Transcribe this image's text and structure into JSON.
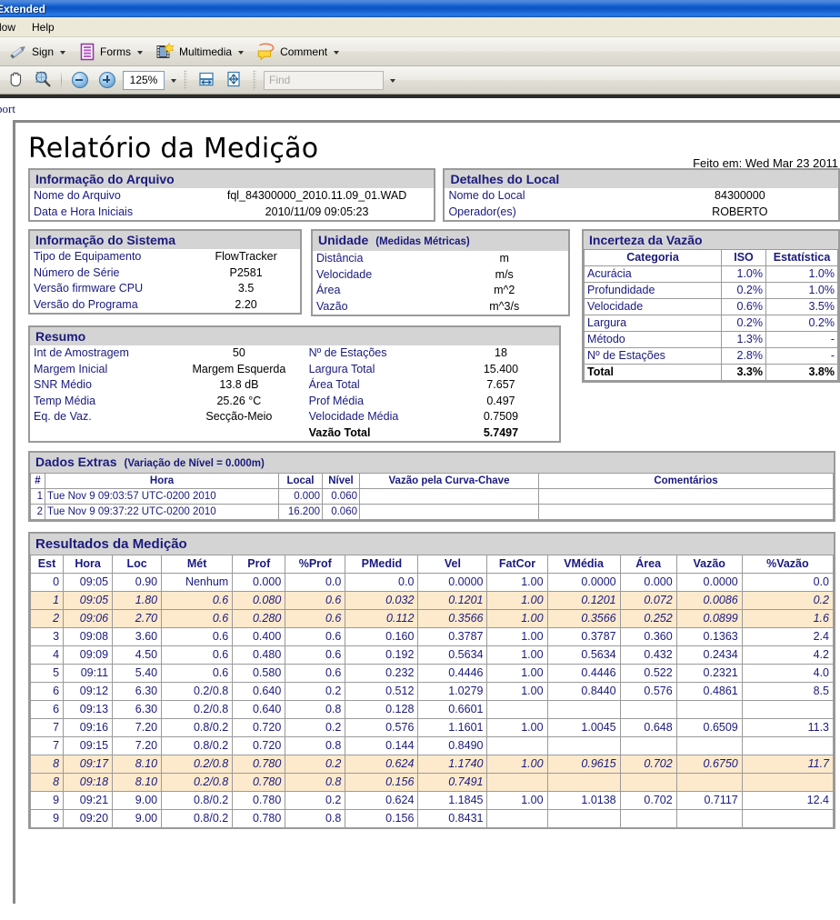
{
  "window": {
    "title": "Extended",
    "menus": [
      "dow",
      "Help"
    ]
  },
  "toolbar": {
    "buttons": [
      {
        "label": "Sign",
        "icon": "pen-icon",
        "caret": true
      },
      {
        "label": "Forms",
        "icon": "forms-icon",
        "caret": true
      },
      {
        "label": "Multimedia",
        "icon": "multimedia-icon",
        "caret": true
      },
      {
        "label": "Comment",
        "icon": "comment-icon",
        "caret": true
      }
    ]
  },
  "toolbar2": {
    "hand_icon": "hand-icon",
    "marquee_zoom_icon": "marquee-zoom-icon",
    "zoom_out_icon": "zoom-out-icon",
    "zoom_in_icon": "zoom-in-icon",
    "zoom_level": "125%",
    "zoom_dropdown_icon": "chevron-down-icon",
    "fit_width_icon": "fit-width-icon",
    "fit_page_icon": "fit-page-icon",
    "find_placeholder": "Find",
    "find_value": "",
    "find_dropdown_icon": "chevron-down-icon"
  },
  "bookmark_strip": {
    "label": "port"
  },
  "report": {
    "title": "Relatório da Medição",
    "made_on": "Feito em: Wed Mar 23 2011",
    "file_info": {
      "header": "Informação do Arquivo",
      "rows": [
        {
          "k": "Nome do Arquivo",
          "v": "fql_84300000_2010.11.09_01.WAD"
        },
        {
          "k": "Data e Hora Iniciais",
          "v": "2010/11/09 09:05:23"
        }
      ]
    },
    "site_details": {
      "header": "Detalhes do Local",
      "rows": [
        {
          "k": "Nome do Local",
          "v": "84300000"
        },
        {
          "k": "Operador(es)",
          "v": "ROBERTO"
        }
      ]
    },
    "system_info": {
      "header": "Informação do Sistema",
      "rows": [
        {
          "k": "Tipo de Equipamento",
          "v": "FlowTracker"
        },
        {
          "k": "Número de Série",
          "v": "P2581"
        },
        {
          "k": "Versão firmware CPU",
          "v": "3.5"
        },
        {
          "k": "Versão do Programa",
          "v": "2.20"
        }
      ]
    },
    "units": {
      "header": "Unidade",
      "header_sub": "(Medidas Métricas)",
      "rows": [
        {
          "k": "Distância",
          "v": "m"
        },
        {
          "k": "Velocidade",
          "v": "m/s"
        },
        {
          "k": "Área",
          "v": "m^2"
        },
        {
          "k": "Vazão",
          "v": "m^3/s"
        }
      ]
    },
    "uncertainty": {
      "header": "Incerteza da Vazão",
      "columns": [
        "Categoria",
        "ISO",
        "Estatística"
      ],
      "rows": [
        {
          "categoria": "Acurácia",
          "iso": "1.0%",
          "estatistica": "1.0%"
        },
        {
          "categoria": "Profundidade",
          "iso": "0.2%",
          "estatistica": "1.0%"
        },
        {
          "categoria": "Velocidade",
          "iso": "0.6%",
          "estatistica": "3.5%"
        },
        {
          "categoria": "Largura",
          "iso": "0.2%",
          "estatistica": "0.2%"
        },
        {
          "categoria": "Método",
          "iso": "1.3%",
          "estatistica": "-"
        },
        {
          "categoria": "Nº de Estações",
          "iso": "2.8%",
          "estatistica": "-"
        },
        {
          "categoria": "Total",
          "iso": "3.3%",
          "estatistica": "3.8%"
        }
      ]
    },
    "summary": {
      "header": "Resumo",
      "left": [
        {
          "k": "Int de Amostragem",
          "v": "50"
        },
        {
          "k": "Margem Inicial",
          "v": "Margem Esquerda"
        },
        {
          "k": "SNR Médio",
          "v": "13.8 dB"
        },
        {
          "k": "Temp Média",
          "v": "25.26 °C"
        },
        {
          "k": "Eq. de Vaz.",
          "v": "Secção-Meio"
        }
      ],
      "right": [
        {
          "k": "Nº de Estações",
          "v": "18"
        },
        {
          "k": "Largura Total",
          "v": "15.400"
        },
        {
          "k": "Área Total",
          "v": "7.657"
        },
        {
          "k": "Prof Média",
          "v": "0.497"
        },
        {
          "k": "Velocidade Média",
          "v": "0.7509"
        },
        {
          "k": "Vazão Total",
          "v": "5.7497"
        }
      ]
    },
    "extras": {
      "header": "Dados Extras",
      "header_sub": "(Variação de Nível = 0.000m)",
      "columns": [
        "#",
        "Hora",
        "Local",
        "Nível",
        "Vazão pela Curva-Chave",
        "Comentários"
      ],
      "rows": [
        {
          "n": "1",
          "hora": "Tue Nov 9 09:03:57 UTC-0200 2010",
          "local": "0.000",
          "nivel": "0.060",
          "vazao_curva": "",
          "comentarios": ""
        },
        {
          "n": "2",
          "hora": "Tue Nov 9 09:37:22 UTC-0200 2010",
          "local": "16.200",
          "nivel": "0.060",
          "vazao_curva": "",
          "comentarios": ""
        }
      ]
    },
    "results": {
      "header": "Resultados da Medição",
      "columns": [
        "Est",
        "Hora",
        "Loc",
        "Mét",
        "Prof",
        "%Prof",
        "PMedid",
        "Vel",
        "FatCor",
        "VMédia",
        "Área",
        "Vazão",
        "%Vazão"
      ],
      "rows": [
        {
          "highlight": false,
          "cells": [
            "0",
            "09:05",
            "0.90",
            "Nenhum",
            "0.000",
            "0.0",
            "0.0",
            "0.0000",
            "1.00",
            "0.0000",
            "0.000",
            "0.0000",
            "0.0"
          ]
        },
        {
          "highlight": true,
          "cells": [
            "1",
            "09:05",
            "1.80",
            "0.6",
            "0.080",
            "0.6",
            "0.032",
            "0.1201",
            "1.00",
            "0.1201",
            "0.072",
            "0.0086",
            "0.2"
          ]
        },
        {
          "highlight": true,
          "cells": [
            "2",
            "09:06",
            "2.70",
            "0.6",
            "0.280",
            "0.6",
            "0.112",
            "0.3566",
            "1.00",
            "0.3566",
            "0.252",
            "0.0899",
            "1.6"
          ]
        },
        {
          "highlight": false,
          "cells": [
            "3",
            "09:08",
            "3.60",
            "0.6",
            "0.400",
            "0.6",
            "0.160",
            "0.3787",
            "1.00",
            "0.3787",
            "0.360",
            "0.1363",
            "2.4"
          ]
        },
        {
          "highlight": false,
          "cells": [
            "4",
            "09:09",
            "4.50",
            "0.6",
            "0.480",
            "0.6",
            "0.192",
            "0.5634",
            "1.00",
            "0.5634",
            "0.432",
            "0.2434",
            "4.2"
          ]
        },
        {
          "highlight": false,
          "cells": [
            "5",
            "09:11",
            "5.40",
            "0.6",
            "0.580",
            "0.6",
            "0.232",
            "0.4446",
            "1.00",
            "0.4446",
            "0.522",
            "0.2321",
            "4.0"
          ]
        },
        {
          "highlight": false,
          "cells": [
            "6",
            "09:12",
            "6.30",
            "0.2/0.8",
            "0.640",
            "0.2",
            "0.512",
            "1.0279",
            "1.00",
            "0.8440",
            "0.576",
            "0.4861",
            "8.5"
          ]
        },
        {
          "highlight": false,
          "cells": [
            "6",
            "09:13",
            "6.30",
            "0.2/0.8",
            "0.640",
            "0.8",
            "0.128",
            "0.6601",
            "",
            "",
            "",
            "",
            ""
          ]
        },
        {
          "highlight": false,
          "cells": [
            "7",
            "09:16",
            "7.20",
            "0.8/0.2",
            "0.720",
            "0.2",
            "0.576",
            "1.1601",
            "1.00",
            "1.0045",
            "0.648",
            "0.6509",
            "11.3"
          ]
        },
        {
          "highlight": false,
          "cells": [
            "7",
            "09:15",
            "7.20",
            "0.8/0.2",
            "0.720",
            "0.8",
            "0.144",
            "0.8490",
            "",
            "",
            "",
            "",
            ""
          ]
        },
        {
          "highlight": true,
          "cells": [
            "8",
            "09:17",
            "8.10",
            "0.2/0.8",
            "0.780",
            "0.2",
            "0.624",
            "1.1740",
            "1.00",
            "0.9615",
            "0.702",
            "0.6750",
            "11.7"
          ]
        },
        {
          "highlight": true,
          "cells": [
            "8",
            "09:18",
            "8.10",
            "0.2/0.8",
            "0.780",
            "0.8",
            "0.156",
            "0.7491",
            "",
            "",
            "",
            "",
            ""
          ]
        },
        {
          "highlight": false,
          "cells": [
            "9",
            "09:21",
            "9.00",
            "0.8/0.2",
            "0.780",
            "0.2",
            "0.624",
            "1.1845",
            "1.00",
            "1.0138",
            "0.702",
            "0.7117",
            "12.4"
          ]
        },
        {
          "highlight": false,
          "cells": [
            "9",
            "09:20",
            "9.00",
            "0.8/0.2",
            "0.780",
            "0.8",
            "0.156",
            "0.8431",
            "",
            "",
            "",
            "",
            ""
          ]
        },
        {
          "highlight": false,
          "cells": [
            "",
            "",
            "",
            "",
            "",
            "",
            "",
            "",
            "",
            "",
            "",
            "",
            ""
          ]
        }
      ]
    }
  },
  "colors": {
    "titlebar_blue": "#0b55c4",
    "report_heading": "#1a1a7e",
    "box_header_bg": "#d4d4d4",
    "highlight_row": "#fdeacd",
    "border_gray": "#9a9a9a"
  }
}
